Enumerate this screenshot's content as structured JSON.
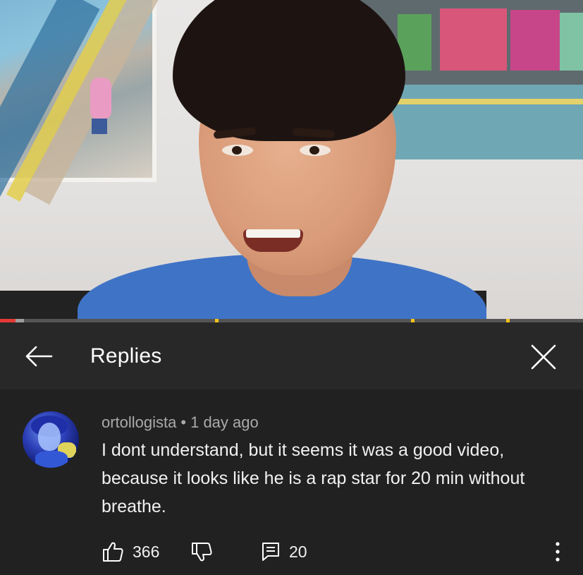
{
  "header": {
    "title": "Replies",
    "back_icon": "arrow-left-icon",
    "close_icon": "close-icon"
  },
  "video": {
    "progress_played": 0.027,
    "progress_buffered": 0.041
  },
  "comment": {
    "author": "ortollogista",
    "separator": "•",
    "time": "1 day ago",
    "text": "I dont understand, but it seems it was a good video, because it looks like he is a rap star for 20 min without breathe.",
    "likes": "366",
    "replies": "20"
  },
  "colors": {
    "panel_bg": "#212121",
    "header_bg": "#282828",
    "meta_text": "#aaaaaa",
    "progress_played": "#e53935",
    "chapter_marker": "#f4c21a"
  }
}
